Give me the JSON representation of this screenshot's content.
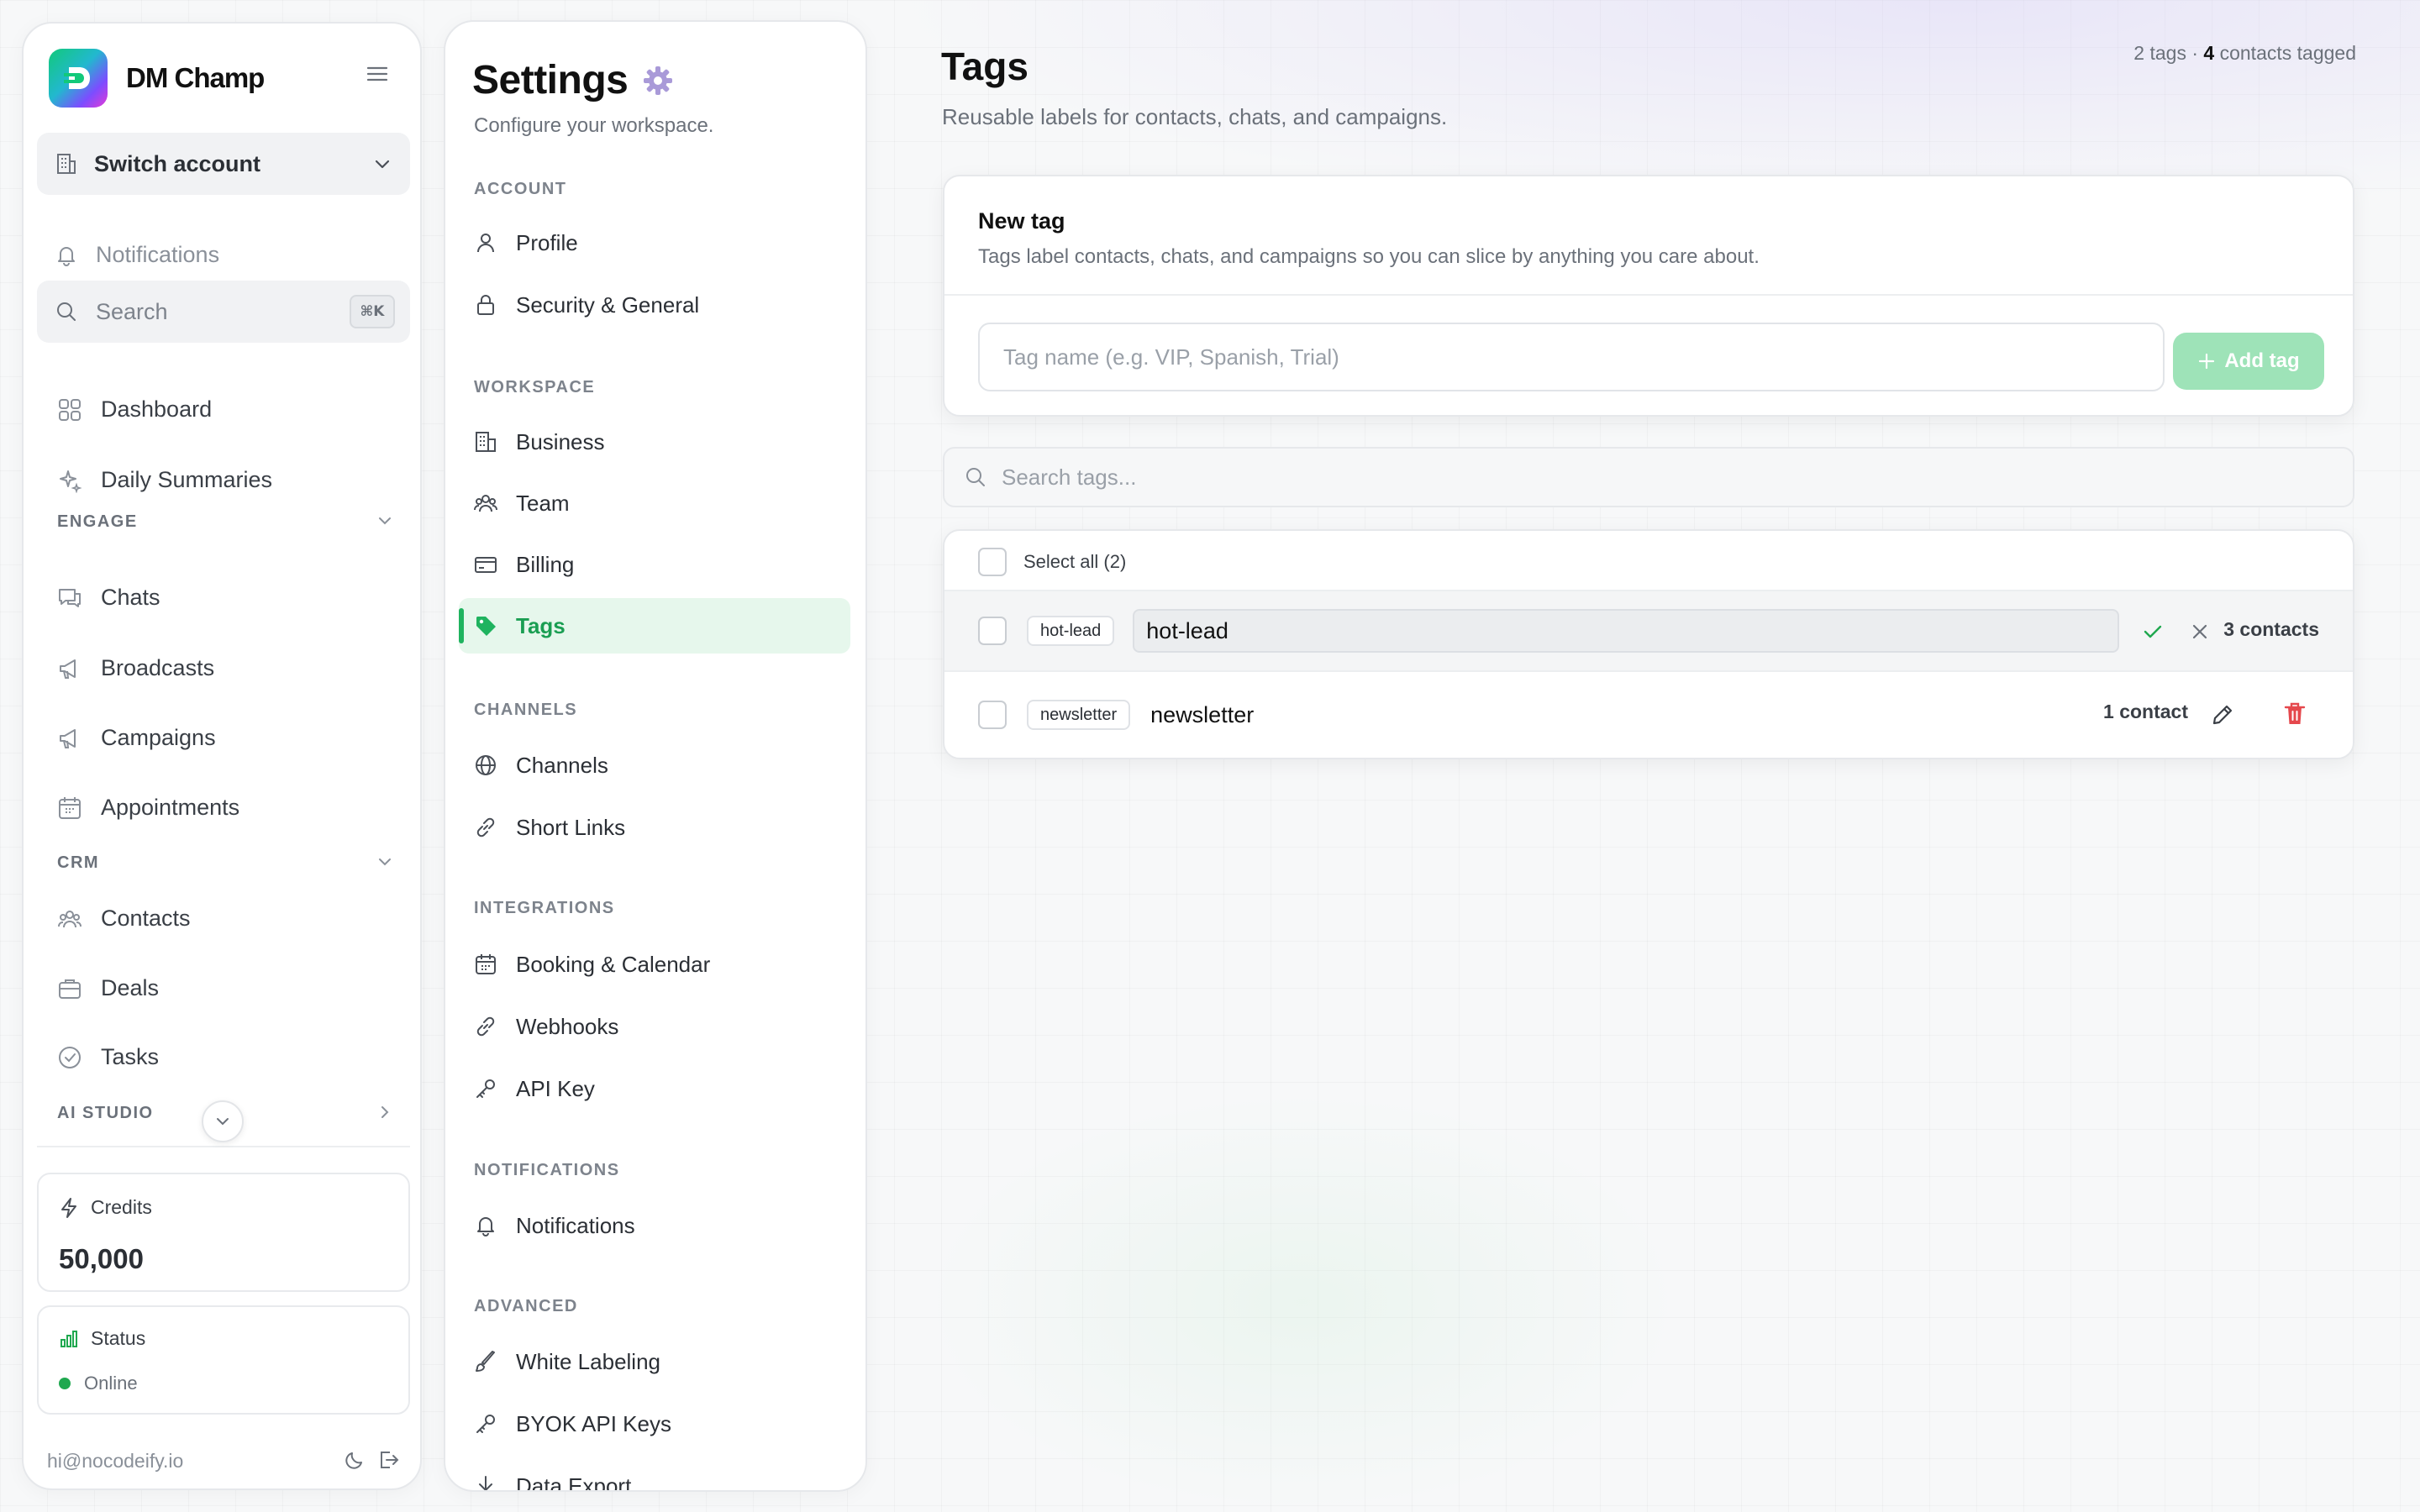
{
  "brand": {
    "name": "DM Champ"
  },
  "sidebar": {
    "switch_account": "Switch account",
    "notifications": "Notifications",
    "search": {
      "label": "Search",
      "shortcut": "⌘K"
    },
    "top_items": [
      {
        "label": "Dashboard",
        "icon": "grid-icon"
      },
      {
        "label": "Daily Summaries",
        "icon": "sparkle-icon"
      }
    ],
    "sections": [
      {
        "title": "ENGAGE",
        "items": [
          {
            "label": "Chats",
            "icon": "chat-icon"
          },
          {
            "label": "Broadcasts",
            "icon": "megaphone-icon"
          },
          {
            "label": "Campaigns",
            "icon": "megaphone-icon"
          },
          {
            "label": "Appointments",
            "icon": "calendar-icon"
          }
        ]
      },
      {
        "title": "CRM",
        "items": [
          {
            "label": "Contacts",
            "icon": "users-icon"
          },
          {
            "label": "Deals",
            "icon": "briefcase-icon"
          },
          {
            "label": "Tasks",
            "icon": "check-circle-icon"
          }
        ]
      },
      {
        "title": "AI STUDIO",
        "items": []
      }
    ],
    "credits": {
      "label": "Credits",
      "value": "50,000"
    },
    "status": {
      "label": "Status",
      "value": "Online",
      "color": "#1fa84f"
    },
    "footer": {
      "email": "hi@nocodeify.io"
    }
  },
  "settings": {
    "title": "Settings",
    "subtitle": "Configure your workspace.",
    "sections": [
      {
        "title": "ACCOUNT",
        "items": [
          {
            "label": "Profile"
          },
          {
            "label": "Security & General"
          }
        ]
      },
      {
        "title": "WORKSPACE",
        "items": [
          {
            "label": "Business"
          },
          {
            "label": "Team"
          },
          {
            "label": "Billing"
          },
          {
            "label": "Tags",
            "active": true
          }
        ]
      },
      {
        "title": "CHANNELS",
        "items": [
          {
            "label": "Channels"
          },
          {
            "label": "Short Links"
          }
        ]
      },
      {
        "title": "INTEGRATIONS",
        "items": [
          {
            "label": "Booking & Calendar"
          },
          {
            "label": "Webhooks"
          },
          {
            "label": "API Key"
          }
        ]
      },
      {
        "title": "NOTIFICATIONS",
        "items": [
          {
            "label": "Notifications"
          }
        ]
      },
      {
        "title": "ADVANCED",
        "items": [
          {
            "label": "White Labeling"
          },
          {
            "label": "BYOK API Keys"
          },
          {
            "label": "Data Export"
          }
        ]
      }
    ]
  },
  "main": {
    "title": "Tags",
    "subtitle": "Reusable labels for contacts, chats, and campaigns.",
    "stats": {
      "tags": "2 tags · ",
      "count": "4",
      "suffix": " contacts tagged"
    },
    "new_tag": {
      "heading": "New tag",
      "description": "Tags label contacts, chats, and campaigns so you can slice by anything you care about.",
      "placeholder": "Tag name (e.g. VIP, Spanish, Trial)",
      "button": "Add tag"
    },
    "search_placeholder": "Search tags...",
    "select_all": "Select all (2)",
    "tags": [
      {
        "chip": "hot-lead",
        "name": "hot-lead",
        "count": "3 contacts",
        "editing": true
      },
      {
        "chip": "newsletter",
        "name": "newsletter",
        "count": "1 contact",
        "editing": false
      }
    ]
  },
  "colors": {
    "accent": "#1fb35f",
    "accent_bg": "#e6f7ec",
    "danger": "#e5484d",
    "add_button": "#9ee3b8"
  }
}
